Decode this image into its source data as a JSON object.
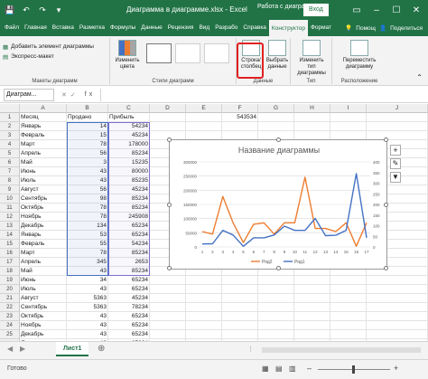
{
  "window": {
    "title": "Диаграмма в диаграмме.xlsx - Excel",
    "context_label": "Работа с диаграм...",
    "signin_label": "Вход",
    "min_icon": "minimize-icon",
    "max_icon": "maximize-icon",
    "close_icon": "close-icon"
  },
  "tabs": [
    "Файл",
    "Главная",
    "Вставка",
    "Разметка",
    "Формулы",
    "Данные",
    "Рецензия",
    "Вид",
    "Разрабо",
    "Справка",
    "Конструктор",
    "Формат"
  ],
  "active_tab": "Конструктор",
  "tabs_right": {
    "help_label": "Помощ",
    "share_label": "Поделиться"
  },
  "ribbon": {
    "add_element": "Добавить элемент диаграммы",
    "express_layout": "Экспресс-макет",
    "group_layouts": "Макеты диаграмм",
    "change_colors": "Изменить цвета",
    "group_styles": "Стили диаграмм",
    "switch_rowcol": "Строка/ столбец",
    "select_data": "Выбрать данные",
    "group_data": "Данные",
    "change_type": "Изменить тип диаграммы",
    "group_type": "Тип",
    "move_chart": "Переместить диаграмму",
    "group_location": "Расположение"
  },
  "formula_bar": {
    "name_box": "Диаграм...",
    "fx_label": "fx"
  },
  "grid": {
    "columns": [
      "A",
      "B",
      "C",
      "D",
      "E",
      "F",
      "G",
      "H",
      "I",
      "J"
    ],
    "rows": [
      "1",
      "2",
      "3",
      "4",
      "5",
      "6",
      "7",
      "8",
      "9",
      "10",
      "11",
      "12",
      "13",
      "14",
      "15",
      "16",
      "17",
      "18",
      "19",
      "20",
      "21",
      "22",
      "23",
      "24",
      "25",
      "26"
    ],
    "headers": [
      "Месяц",
      "Продано",
      "Прибыль"
    ],
    "data": [
      [
        "Январь",
        "14",
        "54234"
      ],
      [
        "Февраль",
        "15",
        "45234"
      ],
      [
        "Март",
        "78",
        "178000"
      ],
      [
        "Апрель",
        "56",
        "85234"
      ],
      [
        "Май",
        "3",
        "15235"
      ],
      [
        "Июнь",
        "43",
        "80000"
      ],
      [
        "Июль",
        "43",
        "85235"
      ],
      [
        "Август",
        "56",
        "45234"
      ],
      [
        "Сентябрь",
        "98",
        "85234"
      ],
      [
        "Октябрь",
        "78",
        "85234"
      ],
      [
        "Ноябрь",
        "78",
        "245908"
      ],
      [
        "Декабрь",
        "134",
        "65234"
      ],
      [
        "Январь",
        "53",
        "65234"
      ],
      [
        "Февраль",
        "55",
        "54234"
      ],
      [
        "Март",
        "78",
        "85234"
      ],
      [
        "Апрель",
        "345",
        "2653"
      ],
      [
        "Май",
        "43",
        "85234"
      ],
      [
        "Июнь",
        "34",
        "65234"
      ],
      [
        "Июль",
        "43",
        "65234"
      ],
      [
        "Август",
        "5363",
        "45234"
      ],
      [
        "Сентябрь",
        "5363",
        "78234"
      ],
      [
        "Октябрь",
        "43",
        "65234"
      ],
      [
        "Ноябрь",
        "43",
        "65234"
      ],
      [
        "Декабрь",
        "43",
        "65234"
      ],
      [
        "Январь",
        "43",
        "65234"
      ]
    ],
    "f1_value": "543534"
  },
  "chart_data": {
    "type": "line",
    "title": "Название диаграммы",
    "x": [
      1,
      2,
      3,
      4,
      5,
      6,
      7,
      8,
      9,
      10,
      11,
      12,
      13,
      14,
      15,
      16,
      17
    ],
    "series": [
      {
        "name": "Ряд2",
        "color": "#ed7d31",
        "axis": "left",
        "values": [
          54234,
          45234,
          178000,
          85234,
          15235,
          80000,
          85235,
          45234,
          85234,
          85234,
          245908,
          65234,
          65234,
          54234,
          85234,
          2653,
          85234
        ]
      },
      {
        "name": "Ряд1",
        "color": "#4472c4",
        "axis": "right",
        "values": [
          14,
          15,
          78,
          56,
          3,
          43,
          43,
          56,
          98,
          78,
          78,
          134,
          53,
          55,
          78,
          345,
          43
        ]
      }
    ],
    "y_left": {
      "min": 0,
      "max": 300000,
      "ticks": [
        "0",
        "50000",
        "100000",
        "150000",
        "200000",
        "250000",
        "300000"
      ]
    },
    "y_right": {
      "min": 0,
      "max": 400,
      "ticks": [
        "0",
        "50",
        "100",
        "150",
        "200",
        "250",
        "300",
        "350",
        "400"
      ]
    },
    "x_ticks": [
      "1",
      "2",
      "3",
      "4",
      "5",
      "6",
      "7",
      "8",
      "9",
      "10",
      "11",
      "12",
      "13",
      "14",
      "15",
      "16",
      "17"
    ],
    "grid": true,
    "legend_position": "bottom"
  },
  "sheet_tab": "Лист1",
  "status": {
    "ready": "Готово"
  }
}
